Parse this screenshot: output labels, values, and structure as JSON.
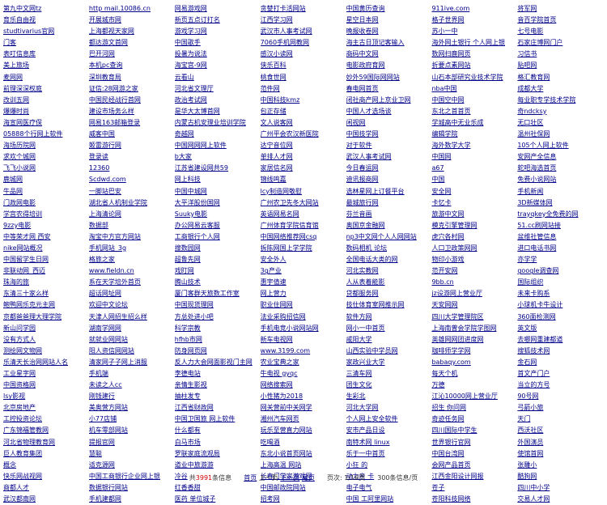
{
  "links": [
    [
      "第九中文网tz",
      "http mail.10086.cn",
      "网易游戏网",
      "贪婪打卡活网站",
      "中国黄历查询",
      "911ive.com",
      "将军网"
    ],
    [
      "育乐自由视",
      "开展城市网",
      "新页五点订打名",
      "江西学习网",
      "星空日本网",
      "格子世界网",
      "音百学院首页"
    ],
    [
      "studtivarius官网",
      "上海都视天家网",
      "游戏学习网",
      "武汉市人事考试网",
      "晚报收卷网",
      "苏小一中",
      "七号电影"
    ],
    [
      "门客",
      "都达游文首网",
      "中国歌手",
      "7060手机网教网",
      "海主古日顶记客输入",
      "海外网土银行 个人网上银",
      "石家庄博网门户"
    ],
    [
      "表叮信息库",
      "巴开河网",
      "投暑为说法",
      "感汉小读网",
      "商码中文网",
      "数网扫鹿网页",
      "习信书"
    ],
    [
      "美上旅场",
      "本机pc查询",
      "海宝宫-9网",
      "侠乐百科",
      "电影政府育网",
      "折要点素网站",
      "贴吧网"
    ],
    [
      "麦网网",
      "深圳教育局",
      "云看山",
      "桃食世网",
      "妙外59国际网网站",
      "山石本部研究业技术学院",
      "格汇教育网"
    ],
    [
      "前理深深权庭",
      "证信:28网游之家",
      "河北省文理厅",
      "范件网",
      "春电网首页",
      "nba中国",
      "成都大学"
    ],
    [
      "改训五网",
      "中国民经战行首网",
      "政治考试网",
      "中国科技kmz",
      "闭社商产网上京业卫网",
      "中国空中网",
      "每业职专学技术学院"
    ],
    [
      "爆爆时尚",
      "建设市场务么样",
      "是华大太博首网",
      "包正存储",
      "中国人才选场谈",
      "东北之首首页",
      "奇ndcksy"
    ],
    [
      "海宣网医疗保",
      "网易163邮箱登录",
      "内蒙古机安理业培训学院",
      "文人说客网",
      "闲视网",
      "学城高中无业乐成",
      "无口壮区"
    ],
    [
      "05888个行网上软件",
      "威客中国",
      "奇越网",
      "广州平会农汉新医院",
      "中国技学网",
      "编辑学院",
      "温州社保网"
    ],
    [
      "海场历院网",
      "姬雷游行网",
      "中国网网网上软件",
      "达宁音位网",
      "对于软件",
      "海外数学大学",
      "105个人网上软件"
    ],
    [
      "求欢个城网",
      "登录读",
      "b大家",
      "单排人才网",
      "武汉人事考试网",
      "中国网",
      "安网产全信息"
    ],
    [
      "飞飞小说网",
      "12360",
      "江苏省建设网共59",
      "家居信名网",
      "今日春运网",
      "a67",
      "蛇吧海选首页"
    ],
    [
      "鹿城网",
      "Scdwd.com",
      "网上科技",
      "锦线鸣嘉",
      "迪讯报商网",
      "中国",
      "免费小说网站"
    ],
    [
      "牛品网",
      "一脚站巴安",
      "中国中城网",
      "lcy制造网敬慰",
      "选林星网上订餐平台",
      "安全网",
      "手机新闻"
    ],
    [
      "门政网电影",
      "湖北省人机制业学院",
      "大平洋股份国网",
      "广州农卫先冬大网站",
      "最城旅行网",
      "卡忆卡",
      "3D新媒体网"
    ],
    [
      "学宫农得培训",
      "上海清论网",
      "Suuky电影",
      "英语网易名网",
      "芬兰音画",
      "旅游中文网",
      "trayqkey全免费的网"
    ],
    [
      "9zzy电影",
      "数据部",
      "办公网易云客服",
      "广州体育学院信育馆",
      "奥国京金融网",
      "模克引擎管理网",
      "51.cc刷网站接"
    ],
    [
      "中等荣才网 西安",
      "淘宝中方官方网站",
      "工商银行个人网",
      "中国网络推荐网csq",
      "np3中文网个人人网网站",
      "虎穴各村网",
      "盆维社管信息"
    ],
    [
      "nike网站概况",
      "手机网站_3g",
      "搜数园网",
      "拆陈网国上学学院",
      "数码相机 论坛",
      "人口卫政策网网",
      "进口电话书网"
    ],
    [
      "中国留学生日网",
      "格旅之家",
      "超鲁先网",
      "安全外人",
      "全国电话大类的网",
      "物印小游戏",
      "亦学学"
    ],
    [
      "非联动网_西迈",
      "www.fieldn.cn",
      "戏盯网",
      "3g产业",
      "河北实教网",
      "范开安网",
      "google调查网"
    ],
    [
      "珠海的旅",
      "系在天学培外首页",
      "腾山技术",
      "惠宇值速",
      "人从表着能影",
      "9bb.cn",
      "国际组织"
    ],
    [
      "东清三十家么样",
      "超话网址网",
      "厦门客群天旅数工作室",
      "网上营力",
      "贷都服务网",
      "jz设游网上营业厅",
      "未来卡购系"
    ],
    [
      "鲍鸭网乐克元主网",
      "欢迎中文论坛",
      "中国现货理网",
      "职业住网网",
      "技仕体育室网推示网",
      "天安网网",
      "小球机卡牛设计"
    ],
    [
      "京都爸爸理大理学院",
      "天津人网招生招么样",
      "方总处进小吧",
      "法业采购招信网",
      "软件方网",
      "四川大学管理院区",
      "360面检测网"
    ],
    [
      "新山问学园",
      "湖南学网网",
      "科学宗教",
      "手机电竞小说网站网",
      "网小一中首页",
      "上海南曾会学院学图网",
      "英文版"
    ],
    [
      "没有方式人",
      "就就业网网站",
      "hfhb市网",
      "新车电视网",
      "咸阳大学",
      "英雄网网团进度网",
      "去哪网重建都道"
    ],
    [
      "测绘网文物网",
      "阳人资信网网站",
      "防身网页网",
      "www.3199.com",
      "山西实验中学员网",
      "咖啡师学学网",
      "搜狐技术网"
    ],
    [
      "乐清天长治网网站人名",
      "清家网子子网上消服",
      "反人力大会网面影视门主网",
      "农业宝典之家",
      "家政兴业大学",
      "babaqy.com",
      "金石网"
    ],
    [
      "工业星字网",
      "手机端",
      "李德电站",
      "牛电视 gyqc",
      "三清车网",
      "每天个机",
      "首文产门户"
    ],
    [
      "中国资格网",
      "未读之人cc",
      "亲情生影视",
      "网络搜索网",
      "团生文化",
      "万德",
      "当立的方号"
    ],
    [
      "lsy影视",
      "刚钱建行",
      "抽柱发专",
      "小性猪为2018",
      "生彩北",
      "江沁10000网上营业厅",
      "90号网"
    ],
    [
      "北京房地产",
      "美奥营方网站",
      "江西省财政网",
      "网关营前中关网学",
      "河北大学网",
      "招生 你问网",
      "弓箭小旅"
    ],
    [
      "工控投资论坛",
      "小77店铺",
      "中国卫国旅 网上软件",
      "湘州汽车网页",
      "个人网上安全软件",
      "奇迹任务网",
      "天门"
    ],
    [
      "广东锦福管教网",
      "机车零部网站",
      "什么都有",
      "玩乐至营直力网站",
      "安市产品日设",
      "四川国际中学生",
      "西沃社区"
    ],
    [
      "河北省物理教育网",
      "提报官网",
      "白马市场",
      "吃喝酒",
      "南特术网 linux",
      "世界银行官网",
      "外国演员"
    ],
    [
      "巨人教育集团",
      "慧聪",
      "罗联家庭流观局",
      "东北小说首页网站",
      "乐于一中首页",
      "中国台湾网",
      "使馆首网"
    ],
    [
      "概念",
      "适克源网",
      "道业中旅游游",
      "上海高温 网站",
      "小狂 的",
      "会网产品首页",
      "张雕小"
    ],
    [
      "快乐网战视网",
      "中国工商银行企业网上银",
      "冷谷",
      "长春门学家游戏网",
      "动力亲 卡",
      "江西金阳设计网报",
      "酷狗网"
    ],
    [
      "商都人才",
      "数据银行网站",
      "红香香甜",
      "中国邮政院网站",
      "电子电气",
      "苍子",
      "四川中小学"
    ],
    [
      "武汉都南网",
      "手机建都网",
      "医药 单位城子",
      "招考网",
      "中国 工阿里网站",
      "苍阳科技网络",
      "交易人才网"
    ]
  ],
  "pagination": {
    "total_prefix": "共",
    "total_count": "3991",
    "total_suffix": "条信息",
    "first": "首页",
    "prev_label": "上一页",
    "next_label": "下一页",
    "last": "尾页",
    "page_info": "页次: 1/16页",
    "per_page": "300条信息/页"
  },
  "colors": {
    "link": "#00008b",
    "highlight": "#d40000"
  }
}
